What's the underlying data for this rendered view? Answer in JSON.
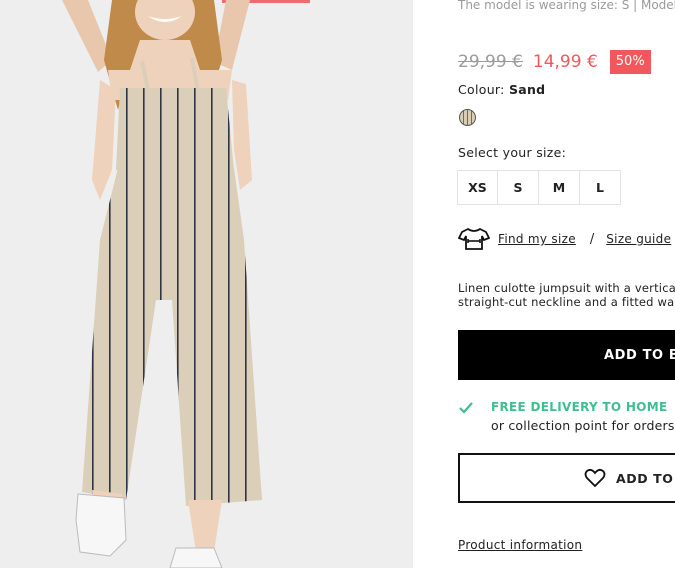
{
  "product": {
    "model_note": "The model is wearing size: S | Model he",
    "old_price": "29,99 €",
    "new_price": "14,99 €",
    "discount": "50%",
    "colour_label": "Colour:",
    "colour_value": "Sand",
    "size_title": "Select your size:",
    "sizes": [
      "XS",
      "S",
      "M",
      "L"
    ],
    "find_my_size": "Find my size",
    "separator": "/",
    "size_guide": "Size guide",
    "description_line1": "Linen culotte jumpsuit with a vertical s",
    "description_line2": "straight-cut neckline and a fitted wais",
    "add_to_bag": "ADD TO BA",
    "delivery_title": "FREE DELIVERY TO HOME",
    "delivery_sub": "or collection point for orders o",
    "add_to_wishlist": "ADD TO W",
    "product_information": "Product information"
  },
  "icons": {
    "swatch": "sand-stripe-swatch",
    "measure": "tshirt-measure-icon",
    "check": "check-icon",
    "heart": "heart-icon"
  },
  "colors": {
    "sale_red": "#f2575d",
    "delivery_green": "#3fbf8f",
    "button_black": "#000000"
  }
}
